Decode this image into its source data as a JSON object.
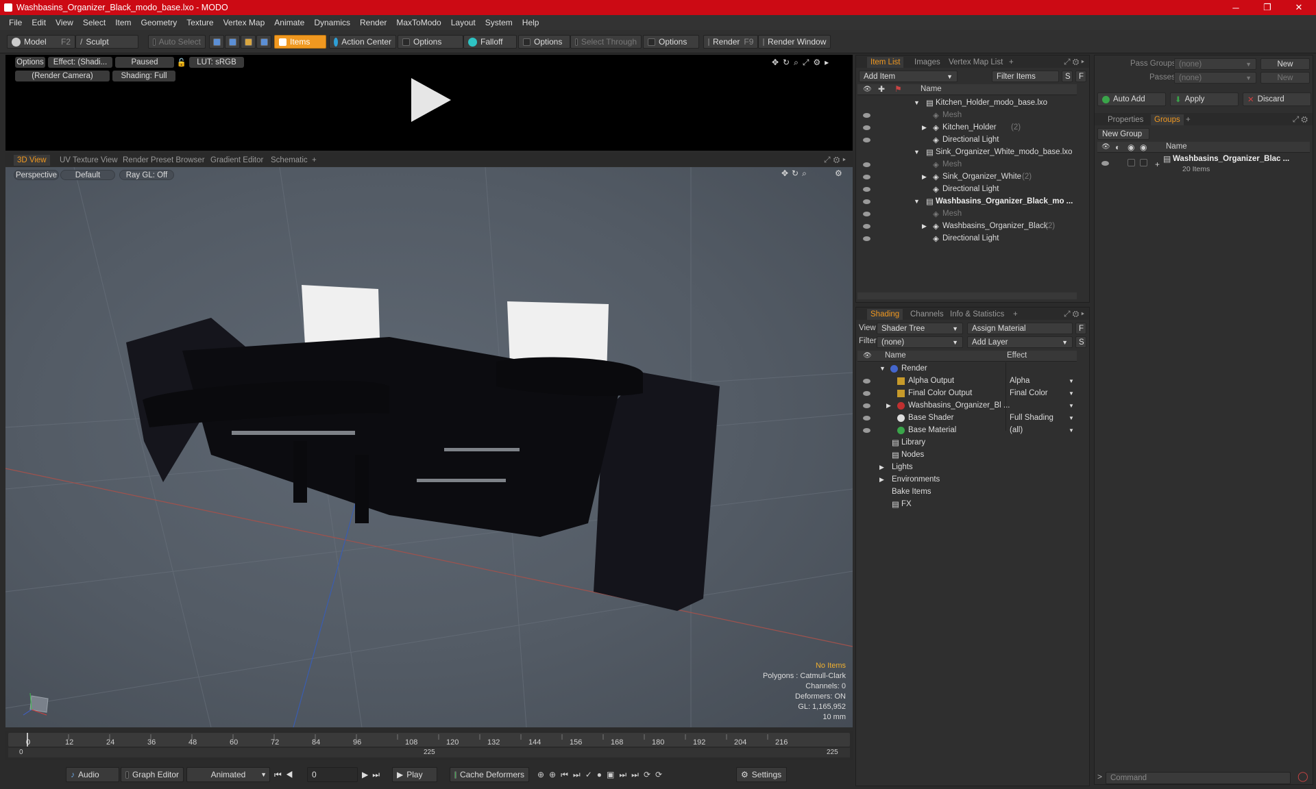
{
  "window": {
    "title": "Washbasins_Organizer_Black_modo_base.lxo - MODO",
    "min": "─",
    "max": "❐",
    "close": "✕"
  },
  "menu": [
    "File",
    "Edit",
    "View",
    "Select",
    "Item",
    "Geometry",
    "Texture",
    "Vertex Map",
    "Animate",
    "Dynamics",
    "Render",
    "MaxToModo",
    "Layout",
    "System",
    "Help"
  ],
  "toolbar": {
    "model": "Model",
    "model_key": "F2",
    "sculpt": "Sculpt",
    "auto_select": "Auto Select",
    "items": "Items",
    "action_center": "Action Center",
    "options1": "Options",
    "falloff": "Falloff",
    "options2": "Options",
    "select_through": "Select Through",
    "options3": "Options",
    "render": "Render",
    "render_key": "F9",
    "render_window": "Render Window"
  },
  "preview": {
    "options": "Options",
    "effect": "Effect: (Shadi...",
    "paused": "Paused",
    "lut": "LUT: sRGB",
    "camera": "(Render Camera)",
    "shading": "Shading: Full"
  },
  "viewtabs": [
    "3D View",
    "UV Texture View",
    "Render Preset Browser",
    "Gradient Editor",
    "Schematic",
    "+"
  ],
  "viewport": {
    "perspective": "Perspective",
    "default": "Default",
    "raygl": "Ray GL: Off",
    "info": {
      "no_items": "No Items",
      "polygons": "Polygons : Catmull-Clark",
      "channels": "Channels: 0",
      "deformers": "Deformers: ON",
      "gl": "GL: 1,165,952",
      "scale": "10 mm"
    }
  },
  "timeline": {
    "ticks": [
      "0",
      "12",
      "24",
      "36",
      "48",
      "60",
      "72",
      "84",
      "96",
      "108",
      "120",
      "132",
      "144",
      "156",
      "168",
      "180",
      "192",
      "204",
      "216"
    ],
    "low": [
      "0",
      "225",
      "225"
    ]
  },
  "bottombar": {
    "audio": "Audio",
    "graph_editor": "Graph Editor",
    "animated": "Animated",
    "frame": "0",
    "play": "Play",
    "cache": "Cache Deformers",
    "settings": "Settings"
  },
  "itemlist": {
    "tabs": [
      "Item List",
      "Images",
      "Vertex Map List",
      "+"
    ],
    "add_item": "Add Item",
    "filter": "Filter Items",
    "s": "S",
    "f": "F",
    "col_name": "Name",
    "rows": [
      {
        "label": "Kitchen_Holder_modo_base.lxo",
        "level": 0,
        "kind": "scene",
        "eye": false
      },
      {
        "label": "Mesh",
        "level": 1,
        "kind": "mesh",
        "eye": true
      },
      {
        "label": "Kitchen_Holder",
        "count": "(2)",
        "level": 1,
        "kind": "group",
        "eye": true
      },
      {
        "label": "Directional Light",
        "level": 1,
        "kind": "light",
        "eye": true
      },
      {
        "label": "Sink_Organizer_White_modo_base.lxo",
        "level": 0,
        "kind": "scene",
        "eye": false
      },
      {
        "label": "Mesh",
        "level": 1,
        "kind": "mesh",
        "eye": true
      },
      {
        "label": "Sink_Organizer_White",
        "count": "(2)",
        "level": 1,
        "kind": "group",
        "eye": true
      },
      {
        "label": "Directional Light",
        "level": 1,
        "kind": "light",
        "eye": true
      },
      {
        "label": "Washbasins_Organizer_Black_mo ...",
        "level": 0,
        "kind": "scene",
        "eye": true,
        "bold": true
      },
      {
        "label": "Mesh",
        "level": 1,
        "kind": "mesh",
        "eye": true
      },
      {
        "label": "Washbasins_Organizer_Black",
        "count": "(2)",
        "level": 1,
        "kind": "group",
        "eye": true
      },
      {
        "label": "Directional Light",
        "level": 1,
        "kind": "light",
        "eye": true
      }
    ]
  },
  "shading": {
    "tabs": [
      "Shading",
      "Channels",
      "Info & Statistics",
      "+"
    ],
    "view_label": "View",
    "view_value": "Shader Tree",
    "assign": "Assign Material",
    "f": "F",
    "filter_label": "Filter",
    "filter_value": "(none)",
    "add_layer": "Add Layer",
    "s": "S",
    "col_name": "Name",
    "col_effect": "Effect",
    "rows": [
      {
        "label": "Render",
        "effect": "",
        "level": 0,
        "eye": false,
        "icon": "#4466cc"
      },
      {
        "label": "Alpha Output",
        "effect": "Alpha",
        "level": 1,
        "eye": true,
        "icon": "#c79a2a"
      },
      {
        "label": "Final Color Output",
        "effect": "Final Color",
        "level": 1,
        "eye": true,
        "icon": "#c79a2a"
      },
      {
        "label": "Washbasins_Organizer_Bl ...",
        "effect": "",
        "level": 1,
        "eye": true,
        "icon": "#c03030"
      },
      {
        "label": "Base Shader",
        "effect": "Full Shading",
        "level": 1,
        "eye": true,
        "icon": "#dddddd"
      },
      {
        "label": "Base Material",
        "effect": "(all)",
        "level": 1,
        "eye": true,
        "icon": "#3aa54a"
      },
      {
        "label": "Library",
        "effect": "",
        "level": 0,
        "eye": false,
        "icon": ""
      },
      {
        "label": "Nodes",
        "effect": "",
        "level": 0,
        "eye": false,
        "icon": ""
      },
      {
        "label": "Lights",
        "effect": "",
        "level": 0,
        "eye": false,
        "icon": ""
      },
      {
        "label": "Environments",
        "effect": "",
        "level": 0,
        "eye": false,
        "icon": ""
      },
      {
        "label": "Bake Items",
        "effect": "",
        "level": 0,
        "eye": false,
        "icon": ""
      },
      {
        "label": "FX",
        "effect": "",
        "level": 0,
        "eye": false,
        "icon": ""
      }
    ]
  },
  "groups": {
    "pass_groups": "Pass Groups",
    "pass_value": "(none)",
    "new": "New",
    "passes": "Passes",
    "passes_value": "(none)",
    "new2": "New",
    "auto_add": "Auto Add",
    "apply": "Apply",
    "discard": "Discard",
    "tabs": [
      "Properties",
      "Groups",
      "+"
    ],
    "new_group": "New Group",
    "col_name": "Name",
    "item_name": "Washbasins_Organizer_Blac ...",
    "item_count": "20 Items"
  },
  "command": {
    "placeholder": "Command"
  }
}
